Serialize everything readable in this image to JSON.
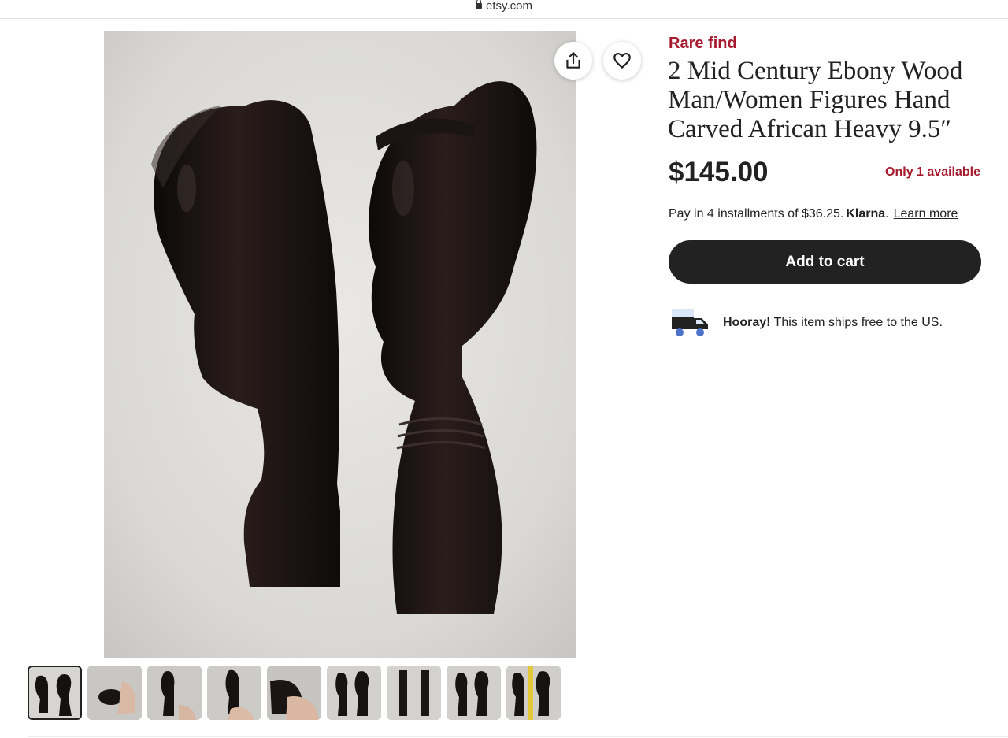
{
  "browser": {
    "url": "etsy.com",
    "lock_icon": "lock-icon"
  },
  "gallery": {
    "main_image_alt": "2 Mid Century Ebony Wood Man/Women Figures",
    "thumbnail_count": 9,
    "selected_index": 0,
    "share_icon": "share-icon",
    "favorite_icon": "heart-icon"
  },
  "listing": {
    "badge": "Rare find",
    "title": "2 Mid Century Ebony Wood Man/Women Figures Hand Carved African Heavy 9.5″",
    "price": "$145.00",
    "stock": "Only 1 available",
    "installments_text": "Pay in 4 installments of $36.25.",
    "klarna": "Klarna",
    "klarna_period": ".",
    "learn_more": "Learn more",
    "cart_button": "Add to cart",
    "shipping_strong": "Hooray!",
    "shipping_text": "This item ships free to the US.",
    "shipping_icon": "truck-icon"
  },
  "colors": {
    "accent_red": "#a61a2e",
    "button_dark": "#222222",
    "text": "#222222"
  }
}
